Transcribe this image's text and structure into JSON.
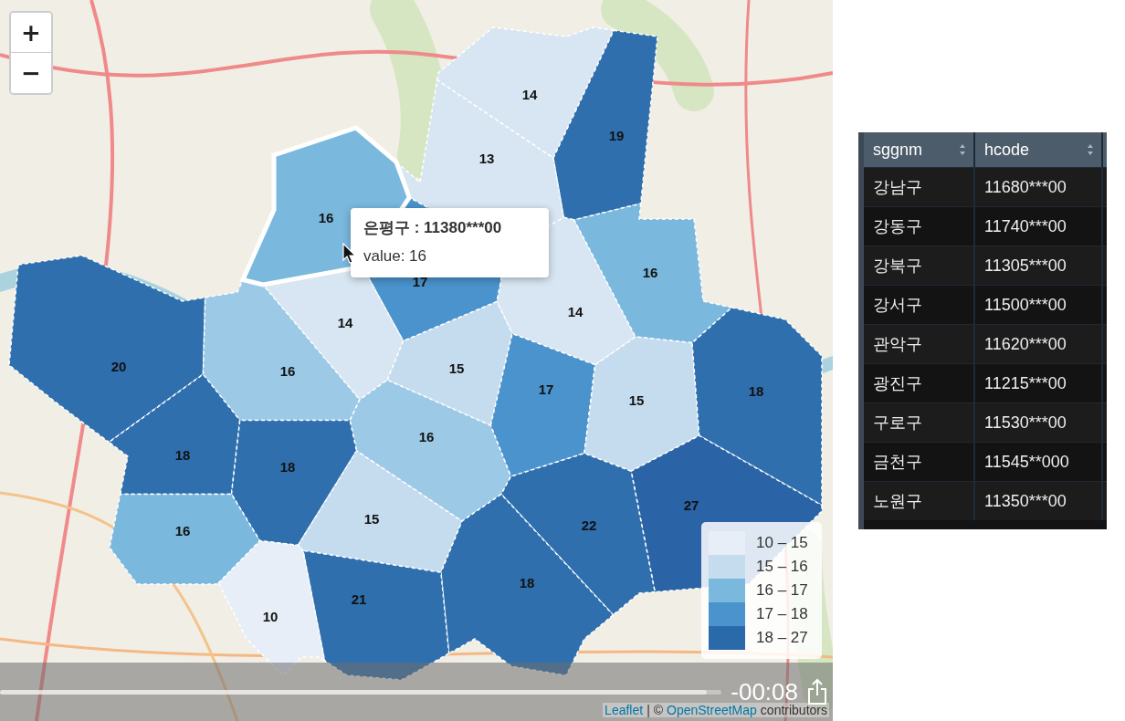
{
  "map": {
    "zoom_controls": [
      "+",
      "−"
    ],
    "districts": [
      {
        "value": "16",
        "color": "#7ab8de",
        "selected": true
      },
      {
        "value": "14",
        "color": "#d7e6f2",
        "selected": false
      },
      {
        "value": "19",
        "color": "#2f6fae",
        "selected": false
      },
      {
        "value": "13",
        "color": "#d7e6f2",
        "selected": false
      },
      {
        "value": "17",
        "color": "#4a93cc",
        "selected": false
      },
      {
        "value": "14",
        "color": "#d7e6f2",
        "selected": false
      },
      {
        "value": "14",
        "color": "#d7e6f2",
        "selected": false
      },
      {
        "value": "16",
        "color": "#7ab8de",
        "selected": false
      },
      {
        "value": "20",
        "color": "#2f6fae",
        "selected": false
      },
      {
        "value": "16",
        "color": "#9cc9e6",
        "selected": false
      },
      {
        "value": "15",
        "color": "#c5dcef",
        "selected": false
      },
      {
        "value": "17",
        "color": "#4a93cc",
        "selected": false
      },
      {
        "value": "15",
        "color": "#c5dcef",
        "selected": false
      },
      {
        "value": "18",
        "color": "#2f6fae",
        "selected": false
      },
      {
        "value": "16",
        "color": "#9cc9e6",
        "selected": false
      },
      {
        "value": "18",
        "color": "#2f6fae",
        "selected": false
      },
      {
        "value": "18",
        "color": "#2f6fae",
        "selected": false
      },
      {
        "value": "27",
        "color": "#2a63a6",
        "selected": false
      },
      {
        "value": "22",
        "color": "#2f6fae",
        "selected": false
      },
      {
        "value": "15",
        "color": "#c5dcef",
        "selected": false
      },
      {
        "value": "16",
        "color": "#7ab8de",
        "selected": false
      },
      {
        "value": "18",
        "color": "#2f6fae",
        "selected": false
      },
      {
        "value": "21",
        "color": "#2f6fae",
        "selected": false
      },
      {
        "value": "10",
        "color": "#e8eef8",
        "selected": false
      }
    ],
    "tooltip": {
      "title": "은평구 : 11380***00",
      "value": "value: 16"
    },
    "legend": [
      {
        "label": "10 – 15",
        "color": "#e8eef8"
      },
      {
        "label": "15 – 16",
        "color": "#c5dcef"
      },
      {
        "label": "16 – 17",
        "color": "#7ab8de"
      },
      {
        "label": "17 – 18",
        "color": "#4a93cc"
      },
      {
        "label": "18 – 27",
        "color": "#2a6aaa"
      }
    ],
    "attribution": {
      "leaflet": "Leaflet",
      "separator": "| ©",
      "osm": "OpenStreetMap",
      "suffix": "contributors"
    }
  },
  "video": {
    "time": "-00:08",
    "level": 0.98
  },
  "table": {
    "columns": [
      {
        "label": "sggnm"
      },
      {
        "label": "hcode"
      }
    ],
    "rows": [
      [
        "강남구",
        "11680***00"
      ],
      [
        "강동구",
        "11740***00"
      ],
      [
        "강북구",
        "11305***00"
      ],
      [
        "강서구",
        "11500***00"
      ],
      [
        "관악구",
        "11620***00"
      ],
      [
        "광진구",
        "11215***00"
      ],
      [
        "구로구",
        "11530***00"
      ],
      [
        "금천구",
        "11545**000"
      ],
      [
        "노원구",
        "11350***00"
      ]
    ]
  }
}
